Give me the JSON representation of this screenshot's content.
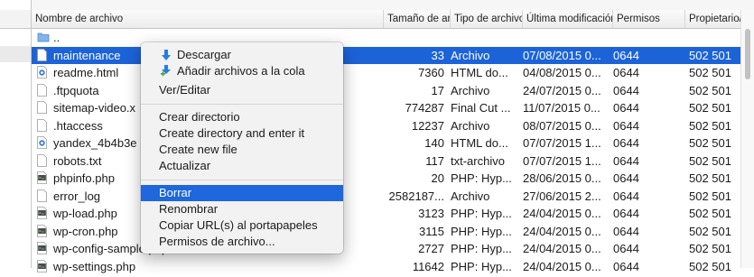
{
  "columns": {
    "name": "Nombre de archivo",
    "size": "Tamaño de archivo",
    "type": "Tipo de archivo",
    "modified": "Última modificación",
    "permissions": "Permisos",
    "owner": "Propietario/Grupo"
  },
  "parent_dir": "..",
  "files": [
    {
      "name": "maintenance",
      "size": "33",
      "type": "Archivo",
      "date": "07/08/2015 0...",
      "perm": "0644",
      "owner": "502 501",
      "icon": "file-icon"
    },
    {
      "name": "readme.html",
      "size": "7360",
      "type": "HTML do...",
      "date": "04/08/2015 0...",
      "perm": "0644",
      "owner": "502 501",
      "icon": "html-file-icon"
    },
    {
      "name": ".ftpquota",
      "size": "17",
      "type": "Archivo",
      "date": "24/07/2015 0...",
      "perm": "0644",
      "owner": "502 501",
      "icon": "file-icon"
    },
    {
      "name": "sitemap-video.x",
      "size": "774287",
      "type": "Final Cut ...",
      "date": "11/07/2015 0...",
      "perm": "0644",
      "owner": "502 501",
      "icon": "file-icon"
    },
    {
      "name": ".htaccess",
      "size": "12237",
      "type": "Archivo",
      "date": "08/07/2015 0...",
      "perm": "0644",
      "owner": "502 501",
      "icon": "file-icon"
    },
    {
      "name": "yandex_4b4b3e",
      "size": "140",
      "type": "HTML do...",
      "date": "07/07/2015 1...",
      "perm": "0644",
      "owner": "502 501",
      "icon": "html-file-icon"
    },
    {
      "name": "robots.txt",
      "size": "117",
      "type": "txt-archivo",
      "date": "07/07/2015 1...",
      "perm": "0644",
      "owner": "502 501",
      "icon": "file-icon"
    },
    {
      "name": "phpinfo.php",
      "size": "20",
      "type": "PHP: Hyp...",
      "date": "28/06/2015 0...",
      "perm": "0644",
      "owner": "502 501",
      "icon": "php-file-icon"
    },
    {
      "name": "error_log",
      "size": "2582187...",
      "type": "Archivo",
      "date": "27/06/2015 2...",
      "perm": "0644",
      "owner": "502 501",
      "icon": "file-icon"
    },
    {
      "name": "wp-load.php",
      "size": "3123",
      "type": "PHP: Hyp...",
      "date": "24/04/2015 0...",
      "perm": "0644",
      "owner": "502 501",
      "icon": "php-file-icon"
    },
    {
      "name": "wp-cron.php",
      "size": "3115",
      "type": "PHP: Hyp...",
      "date": "24/04/2015 0...",
      "perm": "0644",
      "owner": "502 501",
      "icon": "php-file-icon"
    },
    {
      "name": "wp-config-sample.php",
      "size": "2727",
      "type": "PHP: Hyp...",
      "date": "24/04/2015 0...",
      "perm": "0644",
      "owner": "502 501",
      "icon": "php-file-icon"
    },
    {
      "name": "wp-settings.php",
      "size": "11642",
      "type": "PHP: Hyp...",
      "date": "24/04/2015 0...",
      "perm": "0644",
      "owner": "502 501",
      "icon": "php-file-icon"
    }
  ],
  "context_menu": {
    "download": "Descargar",
    "add_to_queue": "Añadir archivos a la cola",
    "view_edit": "Ver/Editar",
    "create_dir": "Crear directorio",
    "create_dir_enter": "Create directory and enter it",
    "create_file": "Create new file",
    "refresh": "Actualizar",
    "delete": "Borrar",
    "rename": "Renombrar",
    "copy_urls": "Copiar URL(s) al portapapeles",
    "permissions": "Permisos de archivo..."
  },
  "colors": {
    "selection": "#1c63d8",
    "menu_highlight": "#1e67dc",
    "download_arrow": "#2a7be0",
    "add_plus": "#3fa83a"
  }
}
